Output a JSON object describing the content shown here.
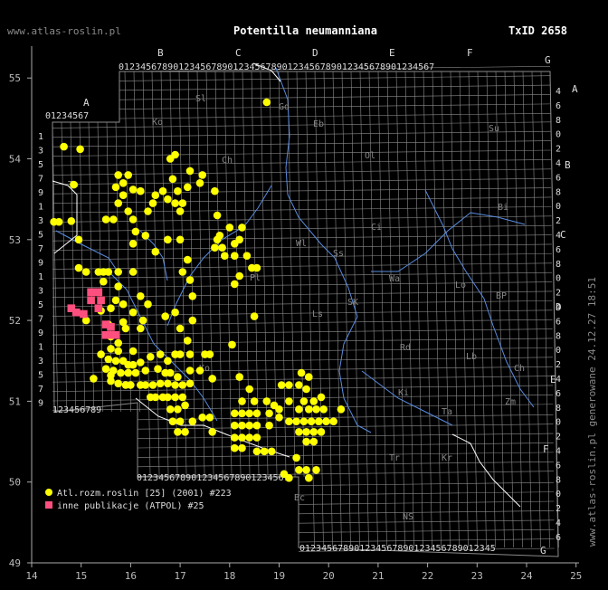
{
  "header": {
    "site": "www.atlas-roslin.pl",
    "title": "Potentilla neumanniana",
    "taxid": "TxID 2658"
  },
  "side_text": "www.atlas-roslin.pl generowane 24.12.27 18:51",
  "map": {
    "lon_ticks": [
      "14",
      "15",
      "16",
      "17",
      "18",
      "19",
      "20",
      "21",
      "22",
      "23",
      "24",
      "25"
    ],
    "lat_ticks": [
      "49",
      "50",
      "51",
      "52",
      "53",
      "54",
      "55"
    ],
    "column_letters": [
      "A",
      "B",
      "C",
      "D",
      "E",
      "F",
      "G"
    ],
    "row_letters": [
      "A",
      "B",
      "C",
      "D",
      "E",
      "F",
      "G"
    ],
    "grid_digits": "0123456789",
    "region_codes": [
      "Sl",
      "Ko",
      "Gd",
      "Eb",
      "Ol",
      "Su",
      "Ch",
      "To",
      "Bi",
      "Ci",
      "Wl",
      "Ss",
      "Pl",
      "Wa",
      "Lo",
      "BP",
      "Ls",
      "SK",
      "Rd",
      "Lb",
      "Ch",
      "Ko",
      "Ki",
      "Tr",
      "Zm",
      "Kr",
      "Ta",
      "NS",
      "Bc"
    ],
    "colors": {
      "grid": "#8c8c8c",
      "water": "#5a8ce0",
      "border": "#ffffff",
      "yellow": "#ffff00",
      "pink": "#ff4f7e"
    }
  },
  "legend": [
    {
      "label": "Atl.rozm.roslin [25] (2001) #223",
      "color": "#ffff00",
      "shape": "circle"
    },
    {
      "label": "inne publikacje (ATPOL) #25",
      "color": "#ff4f7e",
      "shape": "square"
    }
  ],
  "points": {
    "yellow": [
      [
        14.65,
        54.15
      ],
      [
        14.98,
        54.12
      ],
      [
        14.85,
        53.68
      ],
      [
        14.8,
        53.23
      ],
      [
        14.45,
        53.22
      ],
      [
        14.95,
        53.0
      ],
      [
        14.95,
        52.65
      ],
      [
        15.1,
        52.6
      ],
      [
        15.35,
        52.6
      ],
      [
        15.45,
        52.6
      ],
      [
        15.55,
        52.6
      ],
      [
        15.75,
        52.6
      ],
      [
        15.45,
        52.48
      ],
      [
        15.75,
        52.42
      ],
      [
        15.7,
        52.25
      ],
      [
        15.85,
        52.2
      ],
      [
        15.6,
        52.15
      ],
      [
        15.4,
        52.12
      ],
      [
        15.1,
        52.0
      ],
      [
        15.85,
        51.98
      ],
      [
        15.55,
        51.95
      ],
      [
        15.9,
        51.9
      ],
      [
        15.6,
        51.8
      ],
      [
        15.75,
        51.72
      ],
      [
        15.6,
        51.65
      ],
      [
        15.75,
        51.62
      ],
      [
        16.05,
        51.62
      ],
      [
        15.4,
        51.58
      ],
      [
        15.55,
        51.52
      ],
      [
        15.7,
        51.5
      ],
      [
        15.85,
        51.5
      ],
      [
        15.95,
        51.45
      ],
      [
        16.05,
        51.45
      ],
      [
        16.2,
        51.48
      ],
      [
        15.5,
        51.4
      ],
      [
        15.65,
        51.38
      ],
      [
        15.8,
        51.35
      ],
      [
        15.95,
        51.35
      ],
      [
        16.1,
        51.35
      ],
      [
        16.3,
        51.38
      ],
      [
        15.6,
        51.25
      ],
      [
        15.75,
        51.22
      ],
      [
        15.9,
        51.2
      ],
      [
        16.0,
        51.2
      ],
      [
        16.2,
        51.2
      ],
      [
        16.3,
        51.2
      ],
      [
        16.45,
        51.2
      ],
      [
        16.6,
        51.22
      ],
      [
        16.75,
        51.22
      ],
      [
        16.9,
        51.2
      ],
      [
        17.05,
        51.2
      ],
      [
        17.2,
        51.22
      ],
      [
        16.4,
        51.05
      ],
      [
        16.5,
        51.05
      ],
      [
        16.65,
        51.05
      ],
      [
        16.75,
        51.05
      ],
      [
        16.9,
        51.05
      ],
      [
        17.05,
        51.05
      ],
      [
        16.8,
        50.9
      ],
      [
        16.95,
        50.9
      ],
      [
        17.1,
        50.95
      ],
      [
        16.85,
        50.75
      ],
      [
        17.0,
        50.75
      ],
      [
        17.25,
        50.75
      ],
      [
        17.45,
        50.8
      ],
      [
        17.6,
        50.8
      ],
      [
        16.95,
        50.62
      ],
      [
        17.1,
        50.62
      ],
      [
        17.65,
        50.62
      ],
      [
        15.25,
        51.28
      ],
      [
        15.6,
        51.32
      ],
      [
        16.4,
        51.55
      ],
      [
        16.6,
        51.58
      ],
      [
        16.75,
        51.5
      ],
      [
        16.9,
        51.58
      ],
      [
        17.0,
        51.58
      ],
      [
        17.2,
        51.58
      ],
      [
        17.5,
        51.58
      ],
      [
        17.6,
        51.58
      ],
      [
        16.55,
        51.4
      ],
      [
        16.7,
        51.35
      ],
      [
        16.8,
        51.35
      ],
      [
        16.95,
        51.3
      ],
      [
        17.2,
        51.38
      ],
      [
        17.4,
        51.38
      ],
      [
        17.65,
        51.28
      ],
      [
        18.2,
        51.3
      ],
      [
        18.4,
        51.15
      ],
      [
        18.25,
        51.0
      ],
      [
        18.5,
        51.0
      ],
      [
        18.75,
        51.0
      ],
      [
        18.9,
        50.95
      ],
      [
        19.0,
        50.9
      ],
      [
        19.2,
        51.0
      ],
      [
        18.1,
        50.85
      ],
      [
        18.25,
        50.85
      ],
      [
        18.4,
        50.85
      ],
      [
        18.55,
        50.85
      ],
      [
        18.8,
        50.85
      ],
      [
        19.0,
        50.8
      ],
      [
        18.1,
        50.7
      ],
      [
        18.25,
        50.7
      ],
      [
        18.4,
        50.7
      ],
      [
        18.55,
        50.7
      ],
      [
        18.8,
        50.7
      ],
      [
        18.1,
        50.55
      ],
      [
        18.25,
        50.55
      ],
      [
        18.4,
        50.55
      ],
      [
        18.55,
        50.55
      ],
      [
        18.1,
        50.42
      ],
      [
        18.25,
        50.42
      ],
      [
        18.55,
        50.38
      ],
      [
        18.7,
        50.38
      ],
      [
        18.85,
        50.38
      ],
      [
        19.05,
        51.2
      ],
      [
        19.2,
        51.2
      ],
      [
        19.4,
        51.2
      ],
      [
        19.55,
        51.15
      ],
      [
        19.5,
        51.0
      ],
      [
        19.7,
        51.0
      ],
      [
        19.85,
        51.05
      ],
      [
        19.4,
        50.9
      ],
      [
        19.6,
        50.9
      ],
      [
        19.75,
        50.9
      ],
      [
        19.9,
        50.9
      ],
      [
        19.2,
        50.75
      ],
      [
        19.35,
        50.75
      ],
      [
        19.5,
        50.75
      ],
      [
        19.65,
        50.75
      ],
      [
        19.8,
        50.75
      ],
      [
        19.95,
        50.75
      ],
      [
        19.4,
        50.62
      ],
      [
        19.55,
        50.62
      ],
      [
        19.7,
        50.62
      ],
      [
        19.85,
        50.62
      ],
      [
        20.1,
        50.75
      ],
      [
        20.25,
        50.9
      ],
      [
        19.55,
        50.5
      ],
      [
        19.7,
        50.5
      ],
      [
        19.35,
        50.3
      ],
      [
        19.1,
        50.1
      ],
      [
        19.2,
        50.05
      ],
      [
        19.4,
        50.15
      ],
      [
        19.55,
        50.15
      ],
      [
        19.75,
        50.15
      ],
      [
        19.6,
        50.05
      ],
      [
        19.45,
        51.35
      ],
      [
        19.6,
        51.3
      ],
      [
        16.05,
        52.6
      ],
      [
        16.2,
        52.3
      ],
      [
        16.35,
        52.2
      ],
      [
        16.05,
        52.1
      ],
      [
        16.25,
        52.0
      ],
      [
        15.95,
        53.8
      ],
      [
        15.75,
        53.8
      ],
      [
        15.85,
        53.7
      ],
      [
        15.7,
        53.65
      ],
      [
        16.05,
        53.62
      ],
      [
        16.2,
        53.6
      ],
      [
        15.85,
        53.55
      ],
      [
        15.5,
        53.25
      ],
      [
        15.65,
        53.25
      ],
      [
        15.75,
        53.45
      ],
      [
        15.95,
        53.35
      ],
      [
        16.05,
        53.25
      ],
      [
        16.35,
        53.35
      ],
      [
        16.45,
        53.45
      ],
      [
        16.5,
        53.55
      ],
      [
        16.65,
        53.6
      ],
      [
        16.95,
        53.6
      ],
      [
        17.15,
        53.65
      ],
      [
        17.4,
        53.7
      ],
      [
        16.75,
        53.5
      ],
      [
        16.9,
        53.45
      ],
      [
        17.05,
        53.45
      ],
      [
        17.0,
        53.35
      ],
      [
        16.1,
        53.1
      ],
      [
        16.3,
        53.05
      ],
      [
        16.05,
        52.95
      ],
      [
        16.5,
        52.85
      ],
      [
        16.75,
        53.0
      ],
      [
        17.0,
        53.0
      ],
      [
        17.15,
        52.75
      ],
      [
        17.05,
        52.6
      ],
      [
        17.2,
        52.5
      ],
      [
        17.25,
        52.3
      ],
      [
        16.85,
        53.75
      ],
      [
        16.8,
        54.0
      ],
      [
        16.9,
        54.05
      ],
      [
        17.2,
        53.85
      ],
      [
        17.45,
        53.8
      ],
      [
        17.7,
        53.6
      ],
      [
        17.75,
        53.3
      ],
      [
        17.8,
        53.05
      ],
      [
        17.85,
        52.9
      ],
      [
        17.7,
        52.9
      ],
      [
        17.9,
        52.8
      ],
      [
        18.1,
        52.8
      ],
      [
        18.2,
        53.0
      ],
      [
        18.0,
        53.15
      ],
      [
        18.25,
        53.15
      ],
      [
        17.75,
        53.0
      ],
      [
        18.1,
        52.95
      ],
      [
        18.35,
        52.8
      ],
      [
        18.45,
        52.65
      ],
      [
        18.55,
        52.65
      ],
      [
        18.2,
        52.55
      ],
      [
        18.1,
        52.45
      ],
      [
        18.5,
        52.05
      ],
      [
        18.05,
        51.7
      ],
      [
        18.75,
        54.7
      ],
      [
        14.55,
        53.22
      ],
      [
        16.7,
        52.05
      ],
      [
        16.9,
        52.1
      ],
      [
        17.25,
        52.0
      ],
      [
        17.0,
        51.9
      ],
      [
        17.15,
        51.75
      ],
      [
        16.2,
        51.9
      ]
    ],
    "pink": [
      [
        14.8,
        52.15
      ],
      [
        14.9,
        52.1
      ],
      [
        15.05,
        52.08
      ],
      [
        15.2,
        52.35
      ],
      [
        15.35,
        52.35
      ],
      [
        15.2,
        52.25
      ],
      [
        15.4,
        52.25
      ],
      [
        15.35,
        52.15
      ],
      [
        15.5,
        51.95
      ],
      [
        15.6,
        51.92
      ],
      [
        15.5,
        51.82
      ],
      [
        15.6,
        51.82
      ],
      [
        15.7,
        51.82
      ]
    ]
  }
}
